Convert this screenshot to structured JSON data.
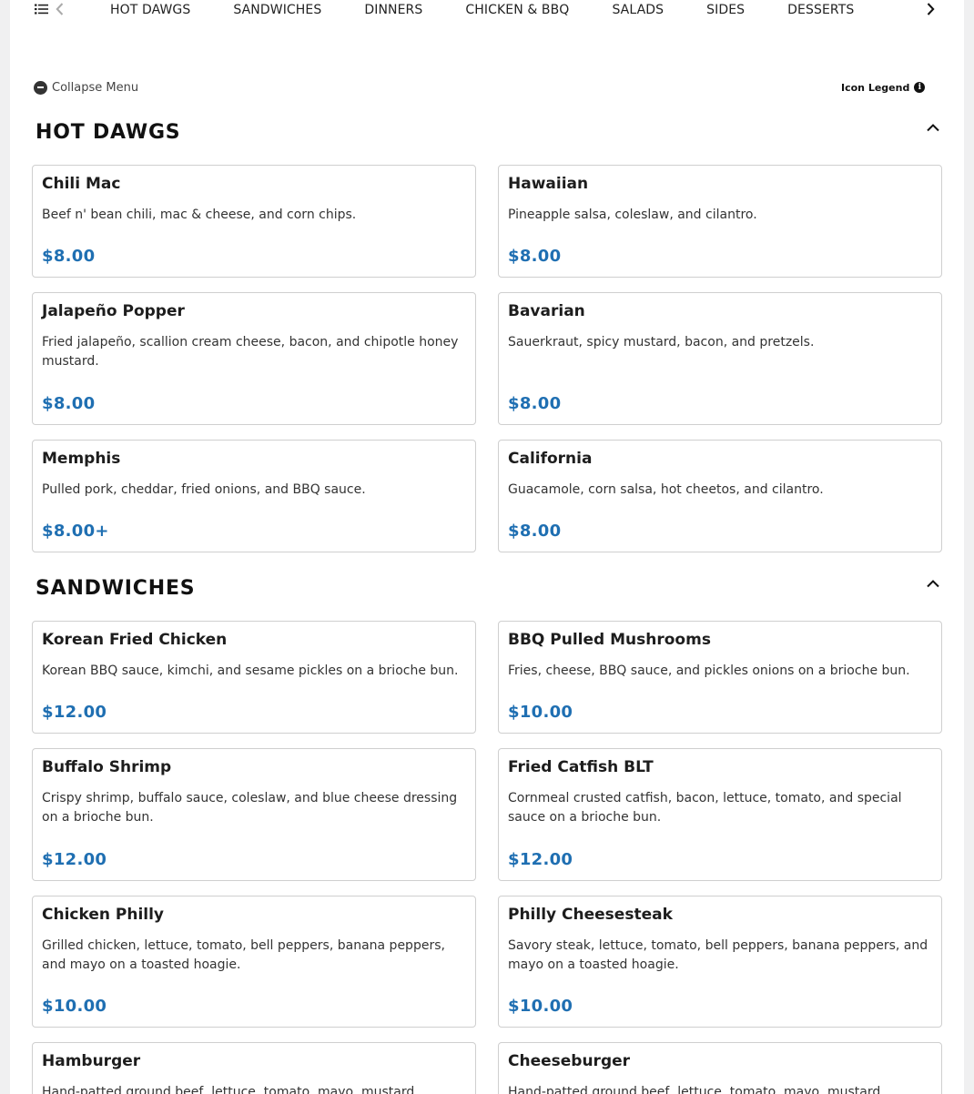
{
  "nav": {
    "categories": [
      "HOT DAWGS",
      "SANDWICHES",
      "DINNERS",
      "CHICKEN & BBQ",
      "SALADS",
      "SIDES",
      "DESSERTS"
    ]
  },
  "toolbar": {
    "collapse_label": "Collapse Menu",
    "legend_label": "Icon Legend",
    "legend_icon_glyph": "i"
  },
  "sections": [
    {
      "title": "HOT DAWGS",
      "items": [
        {
          "name": "Chili Mac",
          "desc": "Beef n' bean chili, mac & cheese, and corn chips.",
          "price": "$8.00"
        },
        {
          "name": "Hawaiian",
          "desc": "Pineapple salsa, coleslaw, and cilantro.",
          "price": "$8.00"
        },
        {
          "name": "Jalapeño Popper",
          "desc": "Fried jalapeño, scallion cream cheese, bacon, and chipotle honey mustard.",
          "price": "$8.00"
        },
        {
          "name": "Bavarian",
          "desc": "Sauerkraut, spicy mustard, bacon, and pretzels.",
          "price": "$8.00"
        },
        {
          "name": "Memphis",
          "desc": "Pulled pork, cheddar, fried onions, and BBQ sauce.",
          "price": "$8.00+"
        },
        {
          "name": "California",
          "desc": "Guacamole, corn salsa, hot cheetos, and cilantro.",
          "price": "$8.00"
        }
      ]
    },
    {
      "title": "SANDWICHES",
      "items": [
        {
          "name": "Korean Fried Chicken",
          "desc": "Korean BBQ sauce, kimchi, and sesame pickles on a brioche bun.",
          "price": "$12.00"
        },
        {
          "name": "BBQ Pulled Mushrooms",
          "desc": "Fries, cheese, BBQ sauce, and pickles onions on a brioche bun.",
          "price": "$10.00"
        },
        {
          "name": "Buffalo Shrimp",
          "desc": "Crispy shrimp, buffalo sauce, coleslaw, and blue cheese dressing on a brioche bun.",
          "price": "$12.00"
        },
        {
          "name": "Fried Catfish BLT",
          "desc": "Cornmeal crusted catfish, bacon, lettuce, tomato, and special sauce on a brioche bun.",
          "price": "$12.00"
        },
        {
          "name": "Chicken Philly",
          "desc": "Grilled chicken, lettuce, tomato, bell peppers, banana peppers, and mayo on a toasted hoagie.",
          "price": "$10.00"
        },
        {
          "name": "Philly Cheesesteak",
          "desc": "Savory steak, lettuce, tomato, bell peppers, banana peppers, and mayo on a toasted hoagie.",
          "price": "$10.00"
        },
        {
          "name": "Hamburger",
          "desc": "Hand-patted ground beef, lettuce, tomato, mayo, mustard",
          "price": ""
        },
        {
          "name": "Cheeseburger",
          "desc": "Hand-patted ground beef, lettuce, tomato, mayo, mustard",
          "price": ""
        }
      ]
    }
  ],
  "colors": {
    "price": "#1f6fb2",
    "card_border": "#cfcfcf",
    "page_bg": "#f0f0f1"
  }
}
